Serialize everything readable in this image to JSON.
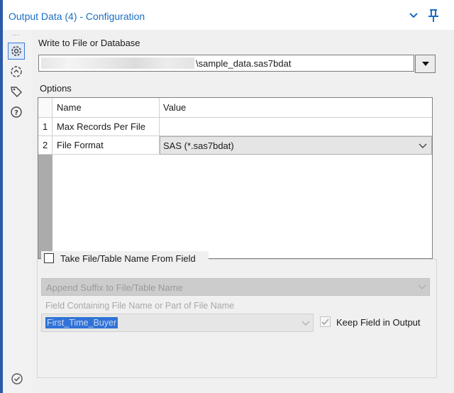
{
  "panel": {
    "title": "Output Data (4) - Configuration"
  },
  "sidebar": {
    "more": "..."
  },
  "write": {
    "label": "Write to File or Database",
    "path": "\\sample_data.sas7bdat"
  },
  "options": {
    "label": "Options",
    "headers": [
      "Name",
      "Value"
    ],
    "rows": [
      {
        "num": "1",
        "name": "Max Records Per File",
        "value": ""
      },
      {
        "num": "2",
        "name": "File Format",
        "value": "SAS (*.sas7bdat)"
      }
    ]
  },
  "take_field": {
    "label": "Take File/Table Name From Field",
    "checked": false,
    "mode": "Append Suffix to File/Table Name",
    "field_label": "Field Containing File Name or Part of File Name",
    "field_value": "First_Time_Buyer",
    "keep_label": "Keep Field in Output",
    "keep_checked": true
  },
  "colors": {
    "accent": "#1b6ec2",
    "border_left": "#2a5aa8",
    "selection": "#3072d6"
  }
}
